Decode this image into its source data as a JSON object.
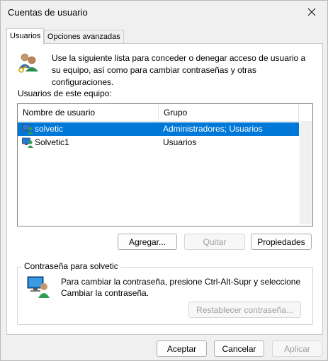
{
  "window": {
    "title": "Cuentas de usuario"
  },
  "tabs": [
    {
      "label": "Usuarios"
    },
    {
      "label": "Opciones avanzadas"
    }
  ],
  "intro": {
    "text": "Use la siguiente lista para conceder o denegar acceso de usuario a su equipo, así como para cambiar contraseñas y otras configuraciones."
  },
  "users_section": {
    "label": "Usuarios de este equipo:",
    "columns": [
      "Nombre de usuario",
      "Grupo"
    ],
    "rows": [
      {
        "name": "solvetic",
        "group": "Administradores; Usuarios"
      },
      {
        "name": "Solvetic1",
        "group": "Usuarios"
      }
    ]
  },
  "buttons": {
    "add": "Agregar...",
    "remove": "Quitar",
    "properties": "Propiedades",
    "reset_password": "Restablecer contraseña...",
    "accept": "Aceptar",
    "cancel": "Cancelar",
    "apply": "Aplicar"
  },
  "password_section": {
    "title": "Contraseña para solvetic",
    "text": "Para cambiar la contraseña, presione Ctrl-Alt-Supr y seleccione Cambiar la contraseña."
  },
  "icons": {
    "close": "close-icon",
    "users": "users-keys-icon",
    "user": "user-computer-icon",
    "password": "password-computer-icon"
  },
  "colors": {
    "selection": "#0078d7",
    "window_bg": "#f0f0f0",
    "panel_bg": "#ffffff"
  }
}
